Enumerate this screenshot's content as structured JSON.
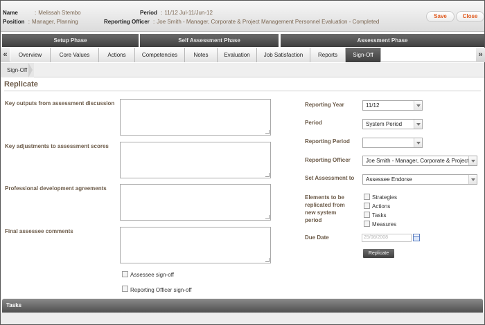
{
  "header": {
    "name_label": "Name",
    "name_value": "Melissah Stembo",
    "position_label": "Position",
    "position_value": "Manager, Planning",
    "period_label": "Period",
    "period_value": "11/12 Jul-11/Jun-12",
    "officer_label": "Reporting Officer",
    "officer_value": "Joe Smith - Manager, Corporate & Project Management Personnel Evaluation - Completed",
    "sep": ":",
    "save_label": "Save",
    "close_label": "Close"
  },
  "phases": [
    "Setup Phase",
    "Self Assessment Phase",
    "Assessment Phase"
  ],
  "tabs": {
    "items": [
      "Overview",
      "Core Values",
      "Actions",
      "Competencies",
      "Notes",
      "Evaluation",
      "Job Satisfaction",
      "Reports",
      "Sign-Off"
    ],
    "active": "Sign-Off",
    "prev_arrow": "«",
    "next_arrow": "»"
  },
  "breadcrumb": {
    "current": "Sign-Off"
  },
  "main": {
    "title": "Replicate",
    "fields": {
      "key_outputs": "Key outputs from assessment discussion",
      "key_adjustments": "Key adjustments to assessment scores",
      "professional_dev": "Professional development agreements",
      "final_comments": "Final assessee comments"
    },
    "assessee_signoff": "Assessee sign-off",
    "officer_signoff": "Reporting Officer sign-off"
  },
  "replicate": {
    "reporting_year_label": "Reporting Year",
    "reporting_year_value": "11/12",
    "period_label": "Period",
    "period_value": "System Period",
    "reporting_period_label": "Reporting Period",
    "reporting_period_value": "",
    "reporting_officer_label": "Reporting Officer",
    "reporting_officer_value": "Joe Smith - Manager, Corporate & Project Man",
    "set_assessment_label": "Set Assessment to",
    "set_assessment_value": "Assessee Endorse",
    "elements_label_1": "Elements to be",
    "elements_label_2": "replicated from",
    "elements_label_3": "new system",
    "elements_label_4": "period",
    "elements": [
      "Strategies",
      "Actions",
      "Tasks",
      "Measures"
    ],
    "due_date_label": "Due Date",
    "due_date_placeholder": "25/08/2008",
    "replicate_button": "Replicate"
  },
  "tasks": {
    "title": "Tasks"
  }
}
